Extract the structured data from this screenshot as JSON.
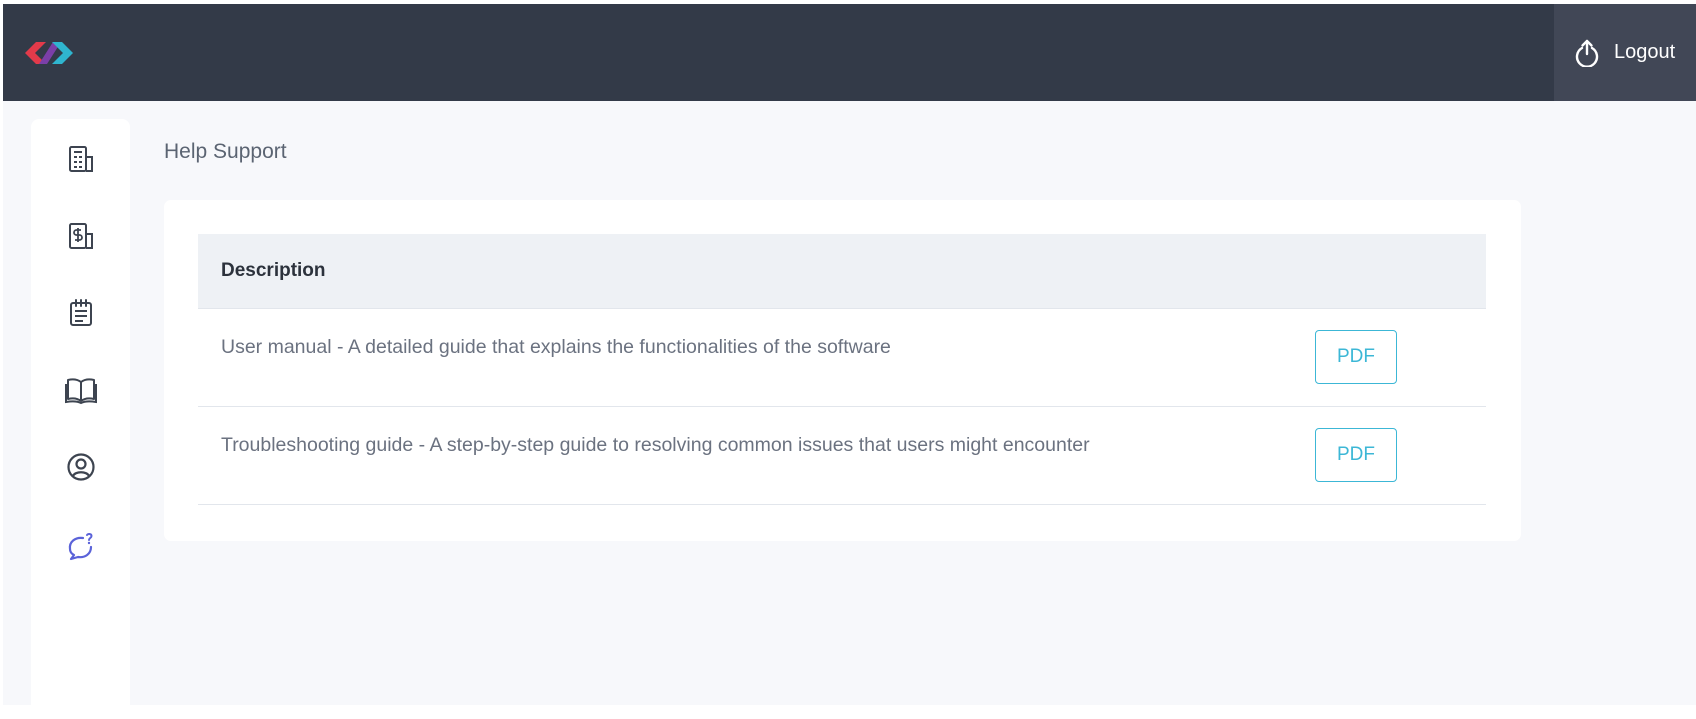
{
  "header": {
    "logout_label": "Logout",
    "icons": {
      "logo": "brand-logo",
      "logout": "power-icon"
    }
  },
  "sidebar": {
    "items": [
      {
        "name": "building-report",
        "icon": "building-report-icon"
      },
      {
        "name": "billing",
        "icon": "building-dollar-icon"
      },
      {
        "name": "notes",
        "icon": "notepad-icon"
      },
      {
        "name": "guide",
        "icon": "open-book-icon"
      },
      {
        "name": "account",
        "icon": "user-circle-icon"
      },
      {
        "name": "help-support",
        "icon": "chat-question-icon",
        "active": true
      }
    ]
  },
  "page": {
    "title": "Help Support"
  },
  "table": {
    "header": "Description",
    "rows": [
      {
        "description": "User manual - A detailed guide that explains the functionalities of the software",
        "action": "PDF"
      },
      {
        "description": "Troubleshooting guide - A step-by-step guide to resolving common issues that users might encounter",
        "action": "PDF"
      }
    ]
  },
  "colors": {
    "topbar": "#333a48",
    "logout_bg": "#414756",
    "accent": "#3cb7d6",
    "active_icon": "#5b63d9",
    "icon": "#3d4450"
  }
}
